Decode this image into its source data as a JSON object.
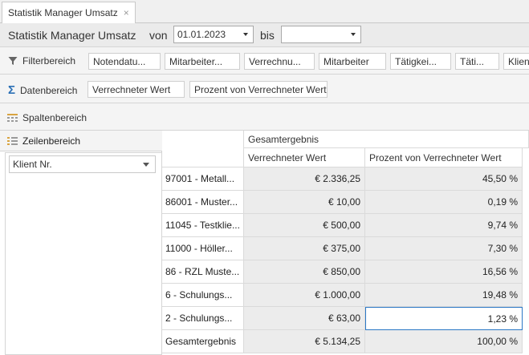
{
  "tab": {
    "label": "Statistik Manager Umsatz",
    "close": "×"
  },
  "toolbar": {
    "title": "Statistik Manager Umsatz",
    "von_label": "von",
    "von_value": "01.01.2023",
    "bis_label": "bis",
    "bis_value": ""
  },
  "filter": {
    "label": "Filterbereich",
    "icon": "funnel-icon",
    "fields": [
      "Notendatu...",
      "Mitarbeiter...",
      "Verrechnu...",
      "Mitarbeiter",
      "Tätigkei...",
      "Täti...",
      "Klient"
    ]
  },
  "data_area": {
    "label": "Datenbereich",
    "icon": "sigma-icon",
    "fields": [
      "Verrechneter Wert",
      "Prozent von Verrechneter Wert"
    ]
  },
  "column_area": {
    "label": "Spaltenbereich",
    "icon": "grid-icon"
  },
  "row_area": {
    "label": "Zeilenbereich",
    "icon": "grid-icon",
    "field": "Klient Nr."
  },
  "grid": {
    "group_header": "Gesamtergebnis",
    "columns": [
      "Verrechneter Wert",
      "Prozent von Verrechneter Wert"
    ],
    "rows": [
      {
        "label": "97001 - Metall...",
        "value": "€ 2.336,25",
        "percent": "45,50 %"
      },
      {
        "label": "86001 - Muster...",
        "value": "€ 10,00",
        "percent": "0,19 %"
      },
      {
        "label": "11045 - Testklie...",
        "value": "€ 500,00",
        "percent": "9,74 %"
      },
      {
        "label": "11000 - Höller...",
        "value": "€ 375,00",
        "percent": "7,30 %"
      },
      {
        "label": "86 - RZL Muste...",
        "value": "€ 850,00",
        "percent": "16,56 %"
      },
      {
        "label": "6 - Schulungs...",
        "value": "€ 1.000,00",
        "percent": "19,48 %"
      },
      {
        "label": "2 - Schulungs...",
        "value": "€ 63,00",
        "percent": "1,23 %"
      }
    ],
    "total": {
      "label": "Gesamtergebnis",
      "value": "€ 5.134,25",
      "percent": "100,00 %"
    }
  },
  "colors": {
    "accent": "#2b78c6",
    "sigma": "#2a6fb5"
  }
}
